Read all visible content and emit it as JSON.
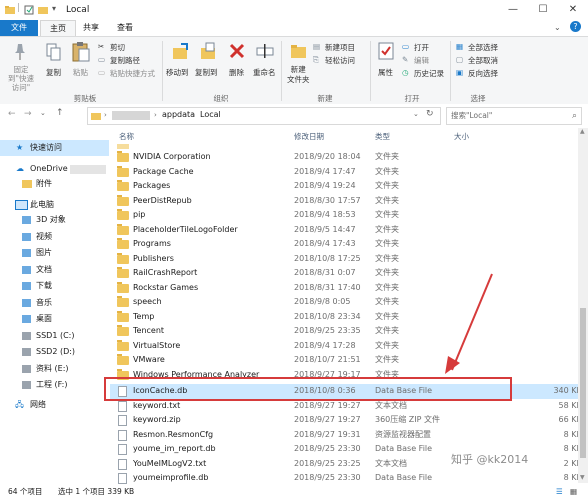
{
  "window": {
    "title": "Local"
  },
  "ribbon_tabs": [
    "文件",
    "主页",
    "共享",
    "查看"
  ],
  "ribbon": {
    "clipboard": {
      "pin": "固定到\"快速访问\"",
      "copy": "复制",
      "paste": "粘贴",
      "cut": "剪切",
      "copy_path": "复制路径",
      "paste_shortcut": "粘贴快捷方式",
      "group": "剪贴板"
    },
    "organize": {
      "move_to": "移动到",
      "copy_to": "复制到",
      "delete": "删除",
      "rename": "重命名",
      "group": "组织"
    },
    "new": {
      "new_folder": "新建\n文件夹",
      "new_item": "新建项目",
      "easy_access": "轻松访问",
      "group": "新建"
    },
    "open": {
      "properties": "属性",
      "open": "打开",
      "edit": "编辑",
      "history": "历史记录",
      "group": "打开"
    },
    "select": {
      "select_all": "全部选择",
      "select_none": "全部取消",
      "invert": "反向选择",
      "group": "选择"
    }
  },
  "address": {
    "path1": "appdata",
    "path2": "Local",
    "search_placeholder": "搜索\"Local\""
  },
  "nav": {
    "quick_access": "快速访问",
    "onedrive": "OneDrive",
    "attachments": "附件",
    "this_pc": "此电脑",
    "items": [
      "3D 对象",
      "视频",
      "图片",
      "文档",
      "下载",
      "音乐",
      "桌面",
      "SSD1 (C:)",
      "SSD2 (D:)",
      "资料 (E:)",
      "工程 (F:)"
    ],
    "network": "网络"
  },
  "columns": {
    "name": "名称",
    "date": "修改日期",
    "type": "类型",
    "size": "大小"
  },
  "files": [
    {
      "name": "NVIDIA Corporation",
      "date": "2018/9/20 18:04",
      "type": "文件夹",
      "size": "",
      "kind": "folder"
    },
    {
      "name": "Package Cache",
      "date": "2018/9/4 17:47",
      "type": "文件夹",
      "size": "",
      "kind": "folder"
    },
    {
      "name": "Packages",
      "date": "2018/9/4 19:24",
      "type": "文件夹",
      "size": "",
      "kind": "folder"
    },
    {
      "name": "PeerDistRepub",
      "date": "2018/8/30 17:57",
      "type": "文件夹",
      "size": "",
      "kind": "folder"
    },
    {
      "name": "pip",
      "date": "2018/9/4 18:53",
      "type": "文件夹",
      "size": "",
      "kind": "folder"
    },
    {
      "name": "PlaceholderTileLogoFolder",
      "date": "2018/9/5 14:47",
      "type": "文件夹",
      "size": "",
      "kind": "folder"
    },
    {
      "name": "Programs",
      "date": "2018/9/4 17:43",
      "type": "文件夹",
      "size": "",
      "kind": "folder"
    },
    {
      "name": "Publishers",
      "date": "2018/10/8 17:25",
      "type": "文件夹",
      "size": "",
      "kind": "folder"
    },
    {
      "name": "RailCrashReport",
      "date": "2018/8/31 0:07",
      "type": "文件夹",
      "size": "",
      "kind": "folder"
    },
    {
      "name": "Rockstar Games",
      "date": "2018/8/31 17:40",
      "type": "文件夹",
      "size": "",
      "kind": "folder"
    },
    {
      "name": "speech",
      "date": "2018/9/8 0:05",
      "type": "文件夹",
      "size": "",
      "kind": "folder"
    },
    {
      "name": "Temp",
      "date": "2018/10/8 23:34",
      "type": "文件夹",
      "size": "",
      "kind": "folder"
    },
    {
      "name": "Tencent",
      "date": "2018/9/25 23:35",
      "type": "文件夹",
      "size": "",
      "kind": "folder"
    },
    {
      "name": "VirtualStore",
      "date": "2018/9/4 17:28",
      "type": "文件夹",
      "size": "",
      "kind": "folder"
    },
    {
      "name": "VMware",
      "date": "2018/10/7 21:51",
      "type": "文件夹",
      "size": "",
      "kind": "folder"
    },
    {
      "name": "Windows Performance Analyzer",
      "date": "2018/9/27 19:17",
      "type": "文件夹",
      "size": "",
      "kind": "folder"
    },
    {
      "name": "IconCache.db",
      "date": "2018/10/8 0:36",
      "type": "Data Base File",
      "size": "340 KB",
      "kind": "file"
    },
    {
      "name": "keyword.txt",
      "date": "2018/9/27 19:27",
      "type": "文本文档",
      "size": "58 KB",
      "kind": "file"
    },
    {
      "name": "keyword.zip",
      "date": "2018/9/27 19:27",
      "type": "360压缩 ZIP 文件",
      "size": "66 KB",
      "kind": "file"
    },
    {
      "name": "Resmon.ResmonCfg",
      "date": "2018/9/27 19:31",
      "type": "资源监视器配置",
      "size": "8 KB",
      "kind": "file"
    },
    {
      "name": "youme_im_report.db",
      "date": "2018/9/25 23:30",
      "type": "Data Base File",
      "size": "8 KB",
      "kind": "file"
    },
    {
      "name": "YouMeIMLogV2.txt",
      "date": "2018/9/25 23:25",
      "type": "文本文档",
      "size": "2 KB",
      "kind": "file"
    },
    {
      "name": "youmeimprofile.db",
      "date": "2018/9/25 23:30",
      "type": "Data Base File",
      "size": "8 KB",
      "kind": "file"
    }
  ],
  "status": {
    "count": "64 个项目",
    "selected": "选中 1 个项目  339 KB"
  },
  "watermark": "知乎 @kk2014",
  "colors": {
    "accent": "#1979ca",
    "selection": "#cce8ff",
    "highlight_box": "#d63b3b"
  }
}
